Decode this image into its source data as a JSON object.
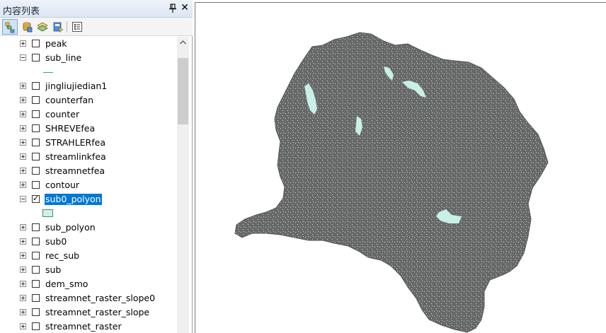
{
  "panel": {
    "title": "内容列表"
  },
  "colors": {
    "selection": "#0078d7",
    "basin_fill": "#686868",
    "lake_fill": "#c8f0e6",
    "line_symbol": "#2aa58c"
  },
  "layers": [
    {
      "name": "peak",
      "expanded": false,
      "checked": false
    },
    {
      "name": "sub_line",
      "expanded": true,
      "checked": false,
      "legend": "line"
    },
    {
      "name": "jingliujiedian1",
      "expanded": false,
      "checked": false
    },
    {
      "name": "counterfan",
      "expanded": false,
      "checked": false
    },
    {
      "name": "counter",
      "expanded": false,
      "checked": false
    },
    {
      "name": "SHREVEfea",
      "expanded": false,
      "checked": false
    },
    {
      "name": "STRAHLERfea",
      "expanded": false,
      "checked": false
    },
    {
      "name": "streamlinkfea",
      "expanded": false,
      "checked": false
    },
    {
      "name": "streamnetfea",
      "expanded": false,
      "checked": false
    },
    {
      "name": "contour",
      "expanded": false,
      "checked": false
    },
    {
      "name": "sub0_polyon",
      "expanded": true,
      "checked": true,
      "selected": true,
      "legend": "polygon"
    },
    {
      "name": "sub_polyon",
      "expanded": false,
      "checked": false
    },
    {
      "name": "sub0",
      "expanded": false,
      "checked": false
    },
    {
      "name": "rec_sub",
      "expanded": false,
      "checked": false
    },
    {
      "name": "sub",
      "expanded": false,
      "checked": false
    },
    {
      "name": "dem_smo",
      "expanded": false,
      "checked": false
    },
    {
      "name": "streamnet_raster_slope0",
      "expanded": false,
      "checked": false
    },
    {
      "name": "streamnet_raster_slope",
      "expanded": false,
      "checked": false
    },
    {
      "name": "streamnet_raster",
      "expanded": false,
      "checked": false
    }
  ]
}
